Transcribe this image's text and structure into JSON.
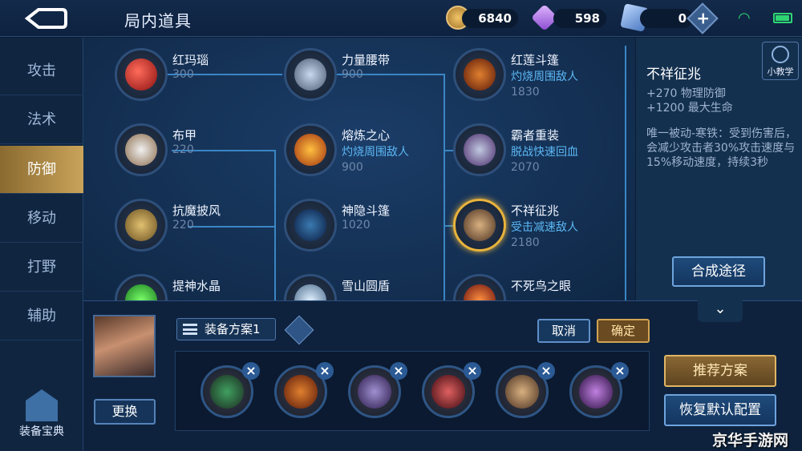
{
  "header": {
    "title": "局内道具"
  },
  "resources": {
    "gold": "6840",
    "diamond": "598",
    "coupon": "0"
  },
  "sidebar": {
    "items": [
      {
        "label": "攻击"
      },
      {
        "label": "法术"
      },
      {
        "label": "防御"
      },
      {
        "label": "移动"
      },
      {
        "label": "打野"
      },
      {
        "label": "辅助"
      }
    ],
    "active": "防御",
    "manual_label": "装备宝典"
  },
  "items": [
    {
      "name": "红玛瑙",
      "price": "300"
    },
    {
      "name": "布甲",
      "price": "220"
    },
    {
      "name": "抗魔披风",
      "price": "220"
    },
    {
      "name": "提神水晶"
    },
    {
      "name": "力量腰带",
      "price": "900"
    },
    {
      "name": "熔炼之心",
      "desc": "灼烧周围敌人",
      "price": "900"
    },
    {
      "name": "神隐斗篷",
      "price": "1020"
    },
    {
      "name": "雪山圆盾"
    },
    {
      "name": "红莲斗篷",
      "desc": "灼烧周围敌人",
      "price": "1830"
    },
    {
      "name": "霸者重装",
      "desc": "脱战快速回血",
      "price": "2070"
    },
    {
      "name": "不祥征兆",
      "desc": "受击减速敌人",
      "price": "2180"
    },
    {
      "name": "不死鸟之眼"
    }
  ],
  "detail": {
    "tutorial_label": "小教学",
    "name": "不祥征兆",
    "stat1": "+270 物理防御",
    "stat2": "+1200 最大生命",
    "passive": "唯一被动-寒铁：受到伤害后，会减少攻击者30%攻击速度与15%移动速度，持续3秒",
    "compose_label": "合成途径"
  },
  "bottom": {
    "swap_label": "更换",
    "plan_label": "装备方案1",
    "cancel_label": "取消",
    "confirm_label": "确定",
    "recommend_label": "推荐方案",
    "restore_label": "恢复默认配置"
  },
  "watermark": "京华手游网",
  "colors": {
    "accent_gold": "#c9a45a",
    "link_blue": "#5cb8f5",
    "bg": "#0d1d35"
  }
}
